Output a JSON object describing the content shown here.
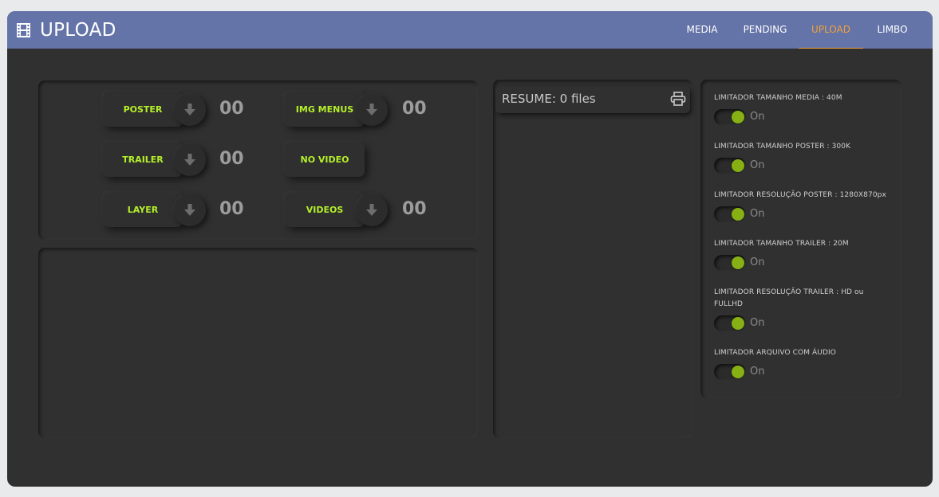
{
  "header": {
    "title": "UPLOAD",
    "logo_icon": "film-icon",
    "nav": [
      {
        "label": "MEDIA",
        "active": false
      },
      {
        "label": "PENDING",
        "active": false
      },
      {
        "label": "UPLOAD",
        "active": true
      },
      {
        "label": "LIMBO",
        "active": false
      }
    ]
  },
  "upload_types": [
    {
      "label": "POSTER",
      "count": "00",
      "has_download": true
    },
    {
      "label": "IMG MENUS",
      "count": "00",
      "has_download": true
    },
    {
      "label": "TRAILER",
      "count": "00",
      "has_download": true
    },
    {
      "label": "NO VIDEO",
      "count": "",
      "has_download": false
    },
    {
      "label": "LAYER",
      "count": "00",
      "has_download": true
    },
    {
      "label": "VIDEOS",
      "count": "00",
      "has_download": true
    }
  ],
  "resume": {
    "text": "RESUME: 0 files",
    "print_icon": "printer-icon"
  },
  "limiters": [
    {
      "label": "LIMITADOR TAMANHO MEDIA : 40M",
      "state": "On",
      "enabled": true
    },
    {
      "label": "LIMITADOR TAMANHO POSTER : 300K",
      "state": "On",
      "enabled": true
    },
    {
      "label": "LIMITADOR RESOLUÇÃO POSTER : 1280X870px",
      "state": "On",
      "enabled": true
    },
    {
      "label": "LIMITADOR TAMANHO TRAILER : 20M",
      "state": "On",
      "enabled": true
    },
    {
      "label": "LIMITADOR RESOLUÇÃO TRAILER : HD ou FULLHD",
      "state": "On",
      "enabled": true
    },
    {
      "label": "LIMITADOR ARQUIVO COM ÁUDIO",
      "state": "On",
      "enabled": true
    }
  ],
  "colors": {
    "header_bg": "#6474a8",
    "active_nav": "#f0a13a",
    "button_text": "#b4f02a",
    "toggle_on": "#86b013",
    "panel_bg": "#303030"
  }
}
